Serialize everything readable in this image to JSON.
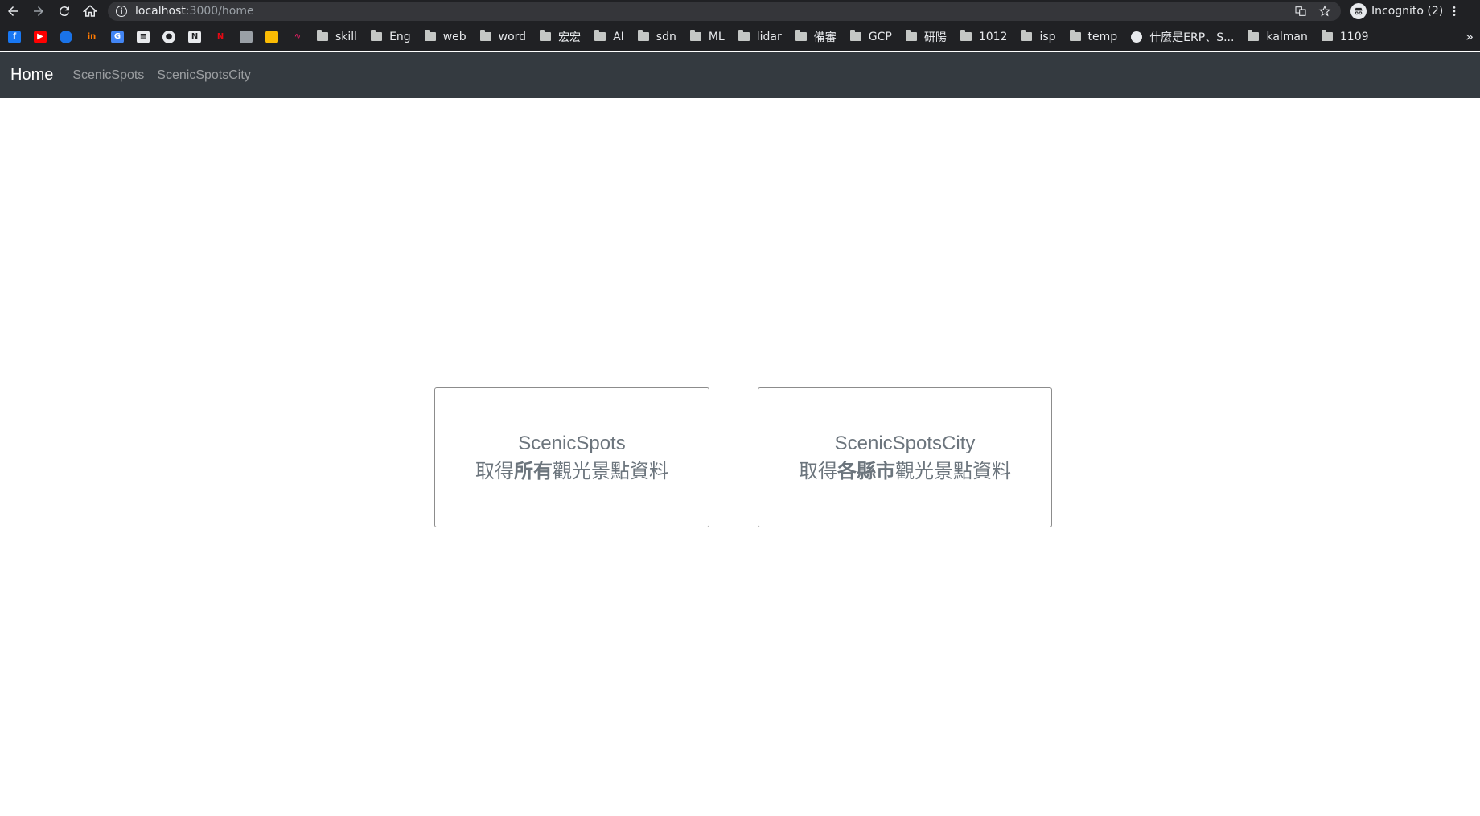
{
  "browser": {
    "url_host": "localhost",
    "url_path": ":3000/home",
    "profile_label": "Incognito (2)",
    "bookmarks": [
      {
        "label": "skill"
      },
      {
        "label": "Eng"
      },
      {
        "label": "web"
      },
      {
        "label": "word"
      },
      {
        "label": "宏宏"
      },
      {
        "label": "AI"
      },
      {
        "label": "sdn"
      },
      {
        "label": "ML"
      },
      {
        "label": "lidar"
      },
      {
        "label": "備審"
      },
      {
        "label": "GCP"
      },
      {
        "label": "研陽"
      },
      {
        "label": "1012"
      },
      {
        "label": "isp"
      },
      {
        "label": "temp"
      }
    ],
    "bookmark_link": "什麼是ERP、S...",
    "bookmarks_tail": [
      {
        "label": "kalman"
      },
      {
        "label": "1109"
      }
    ],
    "overflow_label": "»"
  },
  "navbar": {
    "brand": "Home",
    "links": [
      "ScenicSpots",
      "ScenicSpotsCity"
    ]
  },
  "cards": [
    {
      "title": "ScenicSpots",
      "prefix": "取得",
      "emphasis": "所有",
      "suffix": "觀光景點資料"
    },
    {
      "title": "ScenicSpotsCity",
      "prefix": "取得",
      "emphasis": "各縣市",
      "suffix": "觀光景點資料"
    }
  ]
}
